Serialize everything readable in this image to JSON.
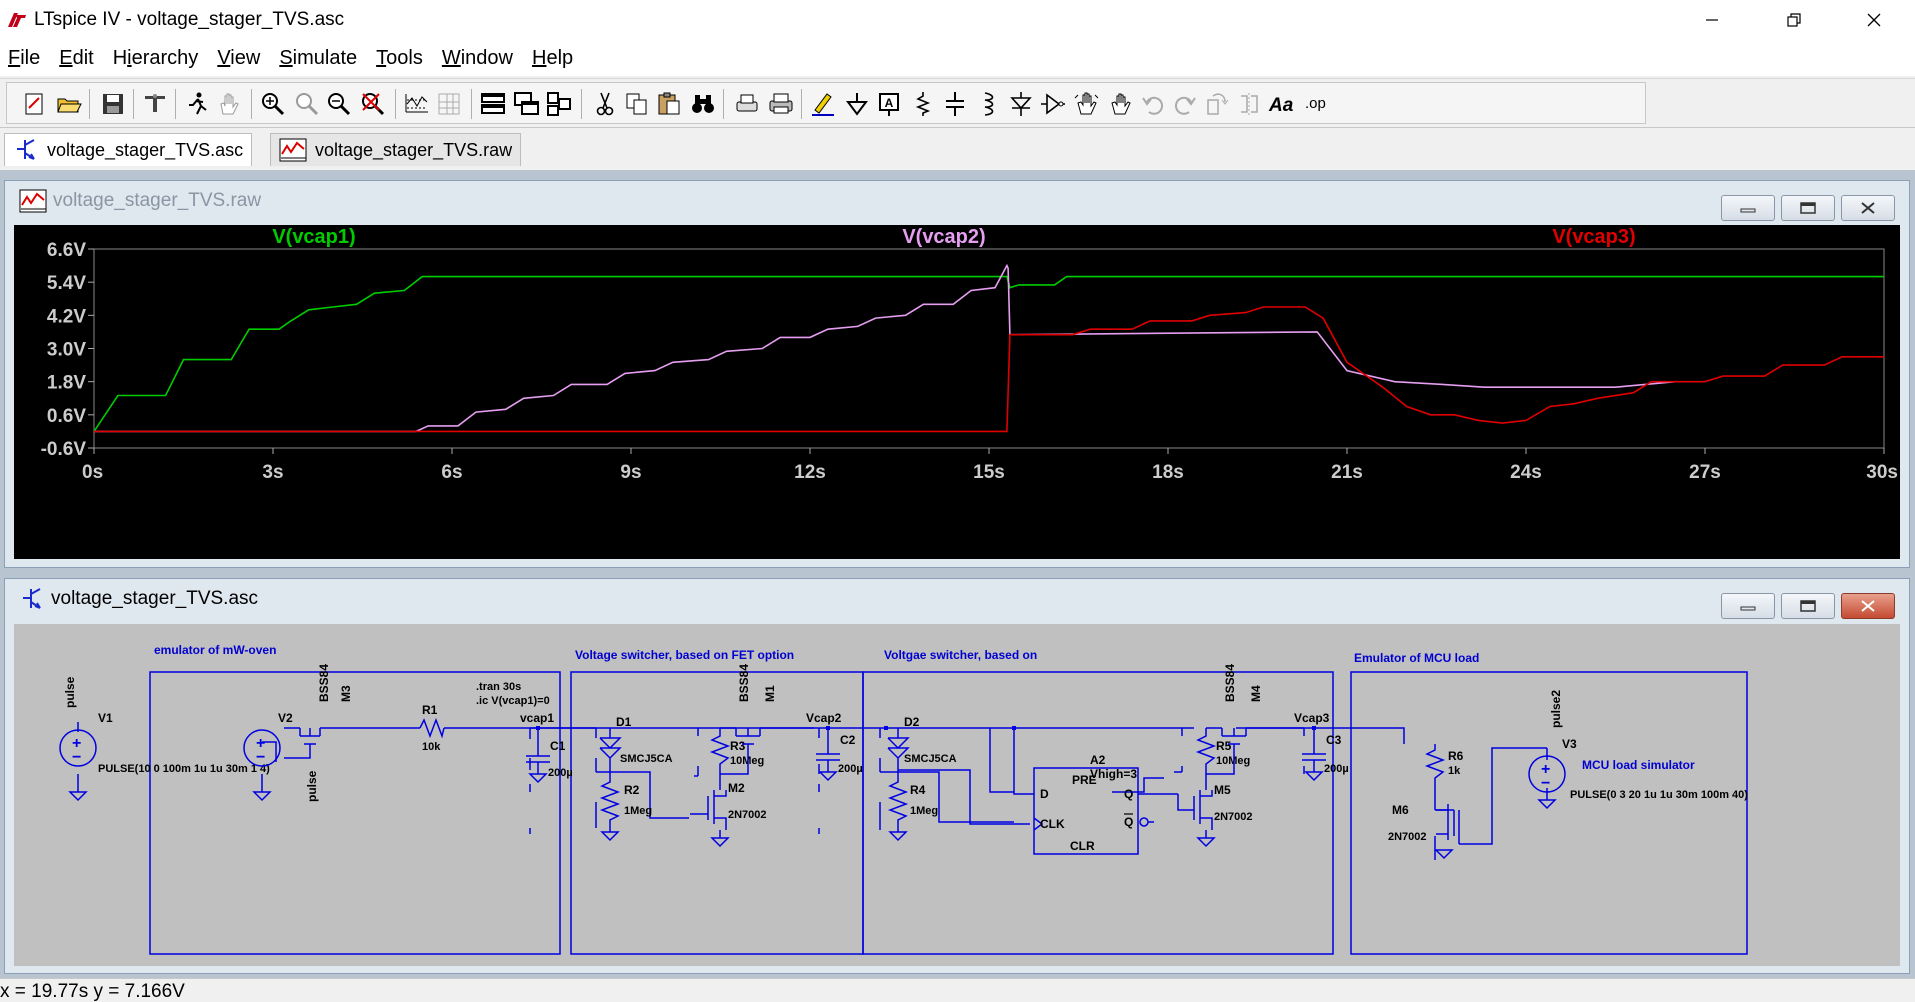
{
  "window": {
    "title": "LTspice IV - voltage_stager_TVS.asc",
    "controls": [
      "minimize-icon",
      "restore-icon",
      "close-icon"
    ]
  },
  "menu": [
    {
      "label": "File",
      "key": "F",
      "rest": "ile"
    },
    {
      "label": "Edit",
      "key": "E",
      "rest": "dit"
    },
    {
      "label": "Hierarchy",
      "key": "",
      "pre": "H",
      "u": "i",
      "rest": "erarchy"
    },
    {
      "label": "View",
      "key": "V",
      "rest": "iew"
    },
    {
      "label": "Simulate",
      "key": "S",
      "rest": "imulate"
    },
    {
      "label": "Tools",
      "key": "T",
      "rest": "ools"
    },
    {
      "label": "Window",
      "key": "W",
      "rest": "indow"
    },
    {
      "label": "Help",
      "key": "H",
      "rest": "elp"
    }
  ],
  "toolbar": {
    "font_label": "Aa",
    "op_label": ".op"
  },
  "tabs": [
    {
      "label": "voltage_stager_TVS.asc",
      "active": true,
      "icon": "schematic-icon"
    },
    {
      "label": "voltage_stager_TVS.raw",
      "active": false,
      "icon": "waveform-icon"
    }
  ],
  "plot_window": {
    "title": "voltage_stager_TVS.raw",
    "icon": "waveform-icon"
  },
  "schematic_window": {
    "title": "voltage_stager_TVS.asc",
    "icon": "schematic-icon"
  },
  "chart_data": {
    "type": "line",
    "background": "#000000",
    "grid": false,
    "xlim": [
      0,
      30
    ],
    "ylim": [
      -0.6,
      6.6
    ],
    "x_unit": "s",
    "y_unit": "V",
    "x_ticks": [
      "0s",
      "3s",
      "6s",
      "9s",
      "12s",
      "15s",
      "18s",
      "21s",
      "24s",
      "27s",
      "30s"
    ],
    "y_ticks": [
      "6.6V",
      "5.4V",
      "4.2V",
      "3.0V",
      "1.8V",
      "0.6V",
      "-0.6V"
    ],
    "series": [
      {
        "name": "V(vcap1)",
        "color": "#00cc00",
        "points": [
          [
            0,
            0
          ],
          [
            0.4,
            1.3
          ],
          [
            1.2,
            1.3
          ],
          [
            1.5,
            2.6
          ],
          [
            2.3,
            2.6
          ],
          [
            2.6,
            3.7
          ],
          [
            3.1,
            3.7
          ],
          [
            3.3,
            4.0
          ],
          [
            3.6,
            4.4
          ],
          [
            4.0,
            4.5
          ],
          [
            4.4,
            4.6
          ],
          [
            4.7,
            5.0
          ],
          [
            5.2,
            5.1
          ],
          [
            5.5,
            5.6
          ],
          [
            15.3,
            5.6
          ],
          [
            15.35,
            5.2
          ],
          [
            15.5,
            5.3
          ],
          [
            16.1,
            5.3
          ],
          [
            16.3,
            5.6
          ],
          [
            30,
            5.6
          ]
        ]
      },
      {
        "name": "V(vcap2)",
        "color": "#e59ef0",
        "points": [
          [
            0,
            0
          ],
          [
            5.4,
            0
          ],
          [
            5.6,
            0.2
          ],
          [
            6.1,
            0.2
          ],
          [
            6.4,
            0.7
          ],
          [
            6.9,
            0.8
          ],
          [
            7.2,
            1.2
          ],
          [
            7.7,
            1.3
          ],
          [
            8.0,
            1.7
          ],
          [
            8.6,
            1.7
          ],
          [
            8.9,
            2.1
          ],
          [
            9.4,
            2.2
          ],
          [
            9.7,
            2.5
          ],
          [
            10.3,
            2.6
          ],
          [
            10.6,
            2.9
          ],
          [
            11.2,
            3.0
          ],
          [
            11.5,
            3.4
          ],
          [
            12.0,
            3.4
          ],
          [
            12.3,
            3.7
          ],
          [
            12.8,
            3.8
          ],
          [
            13.1,
            4.1
          ],
          [
            13.6,
            4.2
          ],
          [
            13.9,
            4.6
          ],
          [
            14.4,
            4.6
          ],
          [
            14.7,
            5.1
          ],
          [
            15.1,
            5.2
          ],
          [
            15.3,
            6.0
          ],
          [
            15.32,
            5.9
          ],
          [
            15.35,
            3.5
          ],
          [
            20.5,
            3.6
          ],
          [
            21.0,
            2.2
          ],
          [
            21.8,
            1.8
          ],
          [
            22.6,
            1.7
          ],
          [
            23.3,
            1.6
          ],
          [
            25.5,
            1.6
          ],
          [
            26.5,
            1.8
          ]
        ]
      },
      {
        "name": "V(vcap3)",
        "color": "#e00000",
        "points": [
          [
            0,
            0
          ],
          [
            15.3,
            0
          ],
          [
            15.35,
            3.5
          ],
          [
            16.4,
            3.5
          ],
          [
            16.7,
            3.7
          ],
          [
            17.4,
            3.7
          ],
          [
            17.7,
            4.0
          ],
          [
            18.4,
            4.0
          ],
          [
            18.7,
            4.2
          ],
          [
            19.3,
            4.3
          ],
          [
            19.6,
            4.5
          ],
          [
            20.3,
            4.5
          ],
          [
            20.6,
            4.1
          ],
          [
            21.0,
            2.5
          ],
          [
            21.6,
            1.6
          ],
          [
            22.0,
            0.9
          ],
          [
            22.4,
            0.6
          ],
          [
            22.8,
            0.6
          ],
          [
            23.2,
            0.4
          ],
          [
            23.6,
            0.3
          ],
          [
            24.0,
            0.4
          ],
          [
            24.4,
            0.9
          ],
          [
            24.8,
            1.0
          ],
          [
            25.2,
            1.2
          ],
          [
            25.8,
            1.4
          ],
          [
            26.1,
            1.8
          ],
          [
            27.0,
            1.8
          ],
          [
            27.3,
            2.0
          ],
          [
            28.0,
            2.0
          ],
          [
            28.3,
            2.4
          ],
          [
            29.0,
            2.4
          ],
          [
            29.3,
            2.7
          ],
          [
            30,
            2.7
          ]
        ]
      }
    ]
  },
  "schematic": {
    "regions": [
      {
        "title": "emulator of mW-oven"
      },
      {
        "title": "Voltage switcher, based on FET option"
      },
      {
        "title": "Voltgae switcher, based on"
      },
      {
        "title": "Emulator of MCU load"
      }
    ],
    "labels": {
      "pulse": "pulse",
      "pulse_rot": "pulse",
      "pulse2": "pulse2",
      "v1": "V1",
      "v2": "V2",
      "v3": "V3",
      "v1_value": "PULSE(10 0 100m 1u 1u 30m 1 4)",
      "v3_value": "PULSE(0 3 20 1u 1u 30m 100m 40)",
      "mcu_sim": "MCU load simulator",
      "bss84_a": "BSS84",
      "bss84_b": "BSS84",
      "bss84_c": "BSS84",
      "m3": "M3",
      "m1": "M1",
      "m4": "M4",
      "r1": "R1",
      "r1_val": "10k",
      "tran": ".tran 30s",
      "ic": ".ic V(vcap1)=0",
      "vcap1": "vcap1",
      "vcap2": "Vcap2",
      "vcap3": "Vcap3",
      "c1": "C1",
      "c1_val": "200µ",
      "c2": "C2",
      "c2_val": "200µ",
      "c3": "C3",
      "c3_val": "200µ",
      "d1": "D1",
      "d2": "D2",
      "smcj_a": "SMCJ5CA",
      "smcj_b": "SMCJ5CA",
      "r2": "R2",
      "r2_val": "1Meg",
      "r3": "R3",
      "r3_val": "10Meg",
      "r4": "R4",
      "r4_val": "1Meg",
      "r5": "R5",
      "r5_val": "10Meg",
      "r6": "R6",
      "r6_val": "1k",
      "m2": "M2",
      "m2_val": "2N7002",
      "m5": "M5",
      "m5_val": "2N7002",
      "m6": "M6",
      "m6_val": "2N7002",
      "a2": "A2",
      "vhigh": "Vhigh=3",
      "pre": "PRE",
      "d": "D",
      "q": "Q",
      "qbar": "Q",
      "clk": "CLK",
      "clr": "CLR"
    }
  },
  "status": {
    "text": "x = 19.77s   y = 7.166V"
  }
}
